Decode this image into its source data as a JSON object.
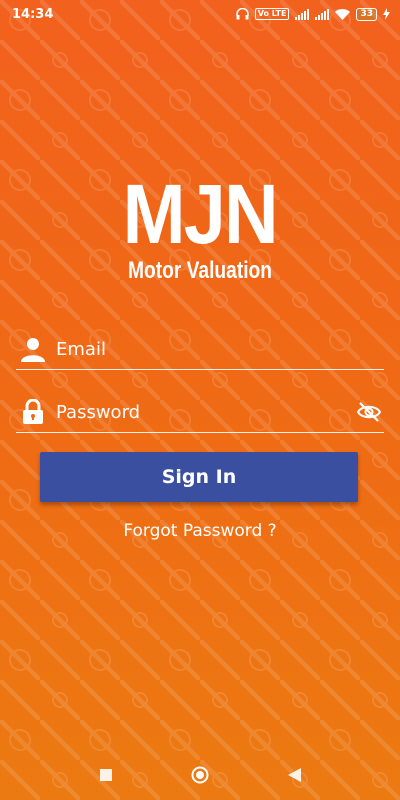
{
  "status_bar": {
    "time": "14:34",
    "sim_label": "Vo LTE",
    "battery": "33"
  },
  "logo": {
    "main": "MJN",
    "sub": "Motor Valuation"
  },
  "login": {
    "email_placeholder": "Email",
    "password_placeholder": "Password",
    "signin_label": "Sign In",
    "forgot_label": "Forgot Password ?"
  },
  "icons": {
    "email": "person-icon",
    "password": "lock-icon",
    "toggle": "eye-off-icon"
  },
  "colors": {
    "background": "#f2611d",
    "button": "#3a4fa0"
  }
}
